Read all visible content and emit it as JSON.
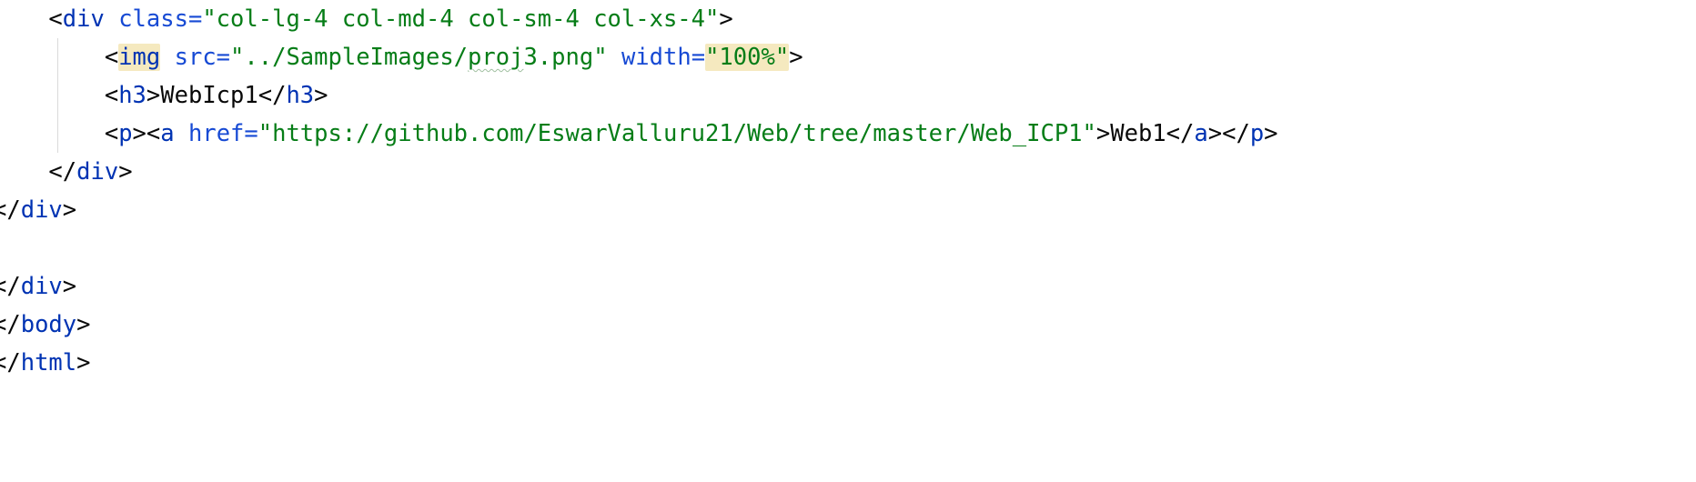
{
  "editor": {
    "lines": [
      {
        "indent": "    ",
        "tokens": [
          "<",
          "div",
          " ",
          "class=",
          "\"col-lg-4 col-md-4 col-sm-4 col-xs-4\"",
          ">"
        ]
      },
      {
        "indent": "        ",
        "tokens": [
          "<",
          "img",
          " ",
          "src=",
          "\"../SampleImages/",
          "proj",
          "3.png\"",
          " ",
          "width=",
          "\"100%\"",
          ">"
        ]
      },
      {
        "indent": "        ",
        "tokens": [
          "<",
          "h3",
          ">",
          "WebIcp1",
          "</",
          "h3",
          ">"
        ]
      },
      {
        "indent": "        ",
        "tokens": [
          "<",
          "p",
          "><",
          "a",
          " ",
          "href=",
          "\"https://github.com/EswarValluru21/Web/tree/master/Web_ICP1\"",
          ">",
          "Web1",
          "</",
          "a",
          "></",
          "p",
          ">"
        ]
      },
      {
        "indent": "    ",
        "tokens": [
          "</",
          "div",
          ">"
        ]
      },
      {
        "indent": "",
        "tokens": [
          "</",
          "div",
          ">"
        ]
      },
      {
        "indent": "",
        "tokens": []
      },
      {
        "indent": "",
        "tokens": [
          "</",
          "div",
          ">"
        ]
      },
      {
        "indent": "",
        "tokens": [
          "</",
          "body",
          ">"
        ]
      },
      {
        "indent": "",
        "tokens": [
          "</",
          "html",
          ">"
        ]
      }
    ]
  },
  "colors": {
    "background": "#ffffff",
    "tag": "#0033b3",
    "attribute": "#174ad4",
    "string": "#067d17",
    "text": "#080808",
    "match_highlight": "#f5e9bf",
    "indent_guide": "#dadada"
  }
}
